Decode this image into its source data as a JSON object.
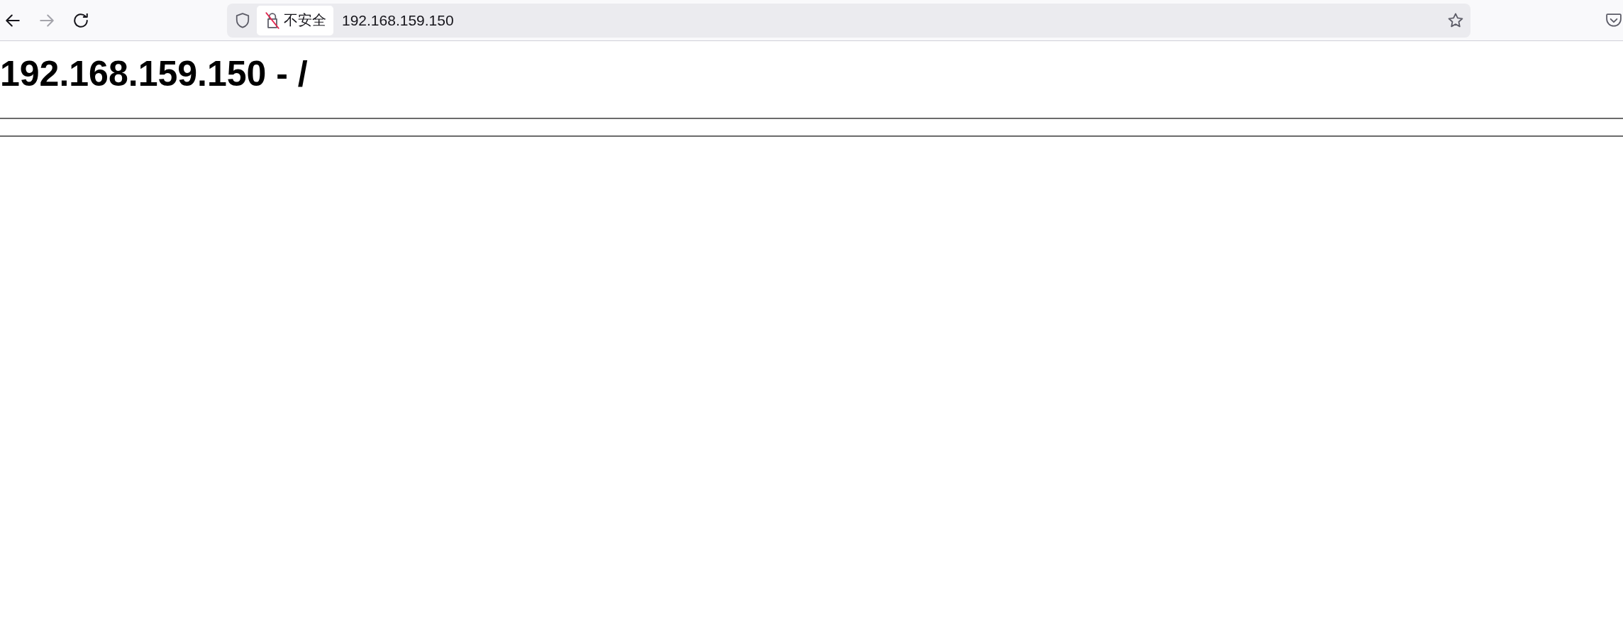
{
  "browser": {
    "nav_buttons": [
      {
        "kind": "back",
        "disabled": false
      },
      {
        "kind": "forward",
        "disabled": true
      },
      {
        "kind": "reload",
        "disabled": false
      }
    ],
    "security_label": "不安全",
    "url": "192.168.159.150"
  },
  "page": {
    "heading": "192.168.159.150 - /"
  }
}
